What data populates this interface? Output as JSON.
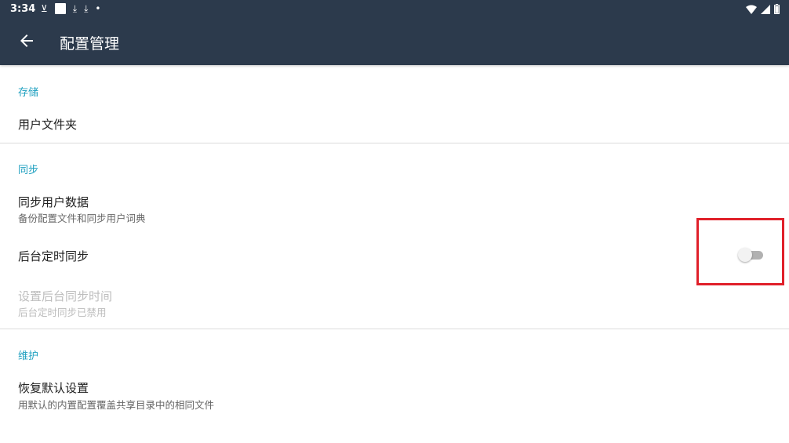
{
  "status_bar": {
    "time": "3:34",
    "left_icons": [
      "sim-icon",
      "square-notification-icon",
      "download-icon",
      "download-icon",
      "dot-icon"
    ],
    "right_icons": [
      "wifi-icon",
      "signal-icon",
      "battery-icon"
    ]
  },
  "app_bar": {
    "title": "配置管理",
    "back_icon": "arrow-back-icon"
  },
  "sections": {
    "storage": {
      "header": "存储",
      "items": [
        {
          "title": "用户文件夹"
        }
      ]
    },
    "sync": {
      "header": "同步",
      "items": [
        {
          "title": "同步用户数据",
          "summary": "备份配置文件和同步用户词典"
        },
        {
          "title": "后台定时同步",
          "toggle": false
        },
        {
          "title": "设置后台同步时间",
          "summary": "后台定时同步已禁用",
          "enabled": false
        }
      ]
    },
    "maintenance": {
      "header": "维护",
      "items": [
        {
          "title": "恢复默认设置",
          "summary": "用默认的内置配置覆盖共享目录中的相同文件"
        }
      ]
    }
  },
  "colors": {
    "app_bar": "#2c3a4c",
    "section_header": "#1fa0c0",
    "highlight_box": "#e0202a"
  }
}
